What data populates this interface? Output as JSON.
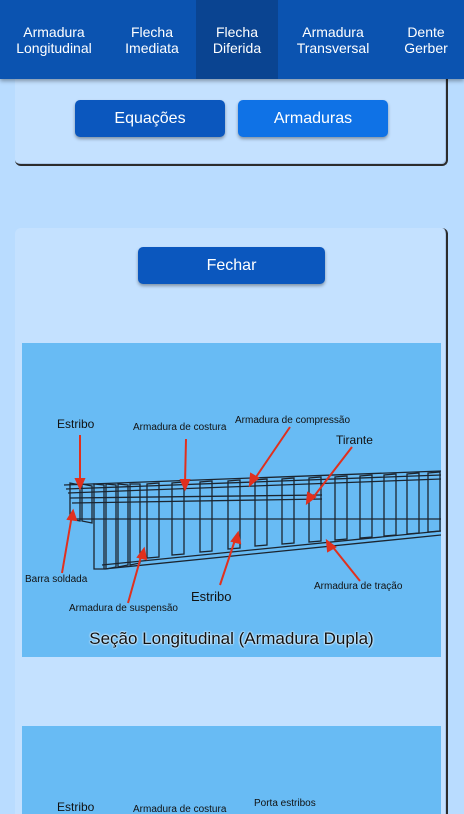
{
  "tabs": [
    {
      "label": "Armadura\nLongitudinal",
      "active": false
    },
    {
      "label": "Flecha\nImediata",
      "active": false
    },
    {
      "label": "Flecha\nDiferida",
      "active": true
    },
    {
      "label": "Armadura\nTransversal",
      "active": false
    },
    {
      "label": "Dente\nGerber",
      "active": false
    }
  ],
  "panel_top": {
    "equations_label": "Equações",
    "reinforcement_label": "Armaduras"
  },
  "panel_bottom": {
    "close_label": "Fechar"
  },
  "figure1": {
    "labels": {
      "estribo_top": "Estribo",
      "armadura_costura": "Armadura de costura",
      "armadura_compressao": "Armadura de compressão",
      "tirante": "Tirante",
      "barra_soldada": "Barra soldada",
      "armadura_suspensao": "Armadura de suspensão",
      "estribo_bottom": "Estribo",
      "armadura_tracao": "Armadura de tração"
    },
    "caption": "Seção Longitudinal (Armadura Dupla)"
  },
  "figure2": {
    "labels": {
      "estribo": "Estribo",
      "armadura_costura": "Armadura de costura",
      "porta_estribos": "Porta estribos"
    }
  },
  "colors": {
    "tabbar": "#0b53b0",
    "tab_active": "#0a4491",
    "background": "#b9dcff",
    "card": "#c4e1ff",
    "figure_bg": "#68bbf4",
    "arrow": "#e0301e"
  }
}
